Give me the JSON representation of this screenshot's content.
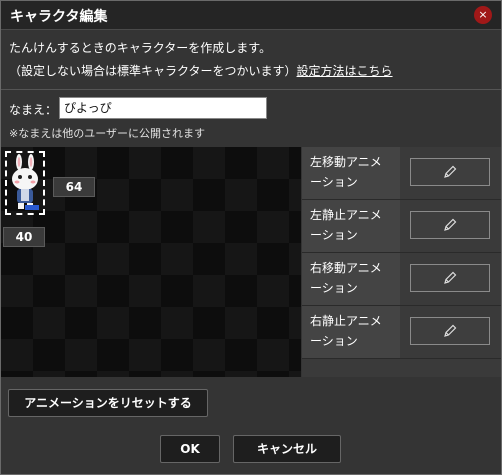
{
  "dialog": {
    "title": "キャラクタ編集",
    "close_glyph": "×"
  },
  "description": {
    "line1": "たんけんするときのキャラクターを作成します。",
    "line2": "（設定しない場合は標準キャラクターをつかいます）",
    "link": "設定方法はこちら"
  },
  "name": {
    "label": "なまえ：",
    "value": "ぴよっぴ",
    "note": "※なまえは他のユーザーに公開されます"
  },
  "sprite": {
    "height_label": "64",
    "width_label": "40"
  },
  "animations": [
    {
      "line1": "左移動アニメ",
      "line2": "ーション",
      "icon": "pencil-icon"
    },
    {
      "line1": "左静止アニメ",
      "line2": "ーション",
      "icon": "pencil-icon"
    },
    {
      "line1": "右移動アニメ",
      "line2": "ーション",
      "icon": "pencil-icon"
    },
    {
      "line1": "右静止アニメ",
      "line2": "ーション",
      "icon": "pencil-icon"
    }
  ],
  "buttons": {
    "reset": "アニメーションをリセットする",
    "ok": "OK",
    "cancel": "キャンセル"
  },
  "colors": {
    "close_button": "#a01818",
    "background": "#343434"
  }
}
